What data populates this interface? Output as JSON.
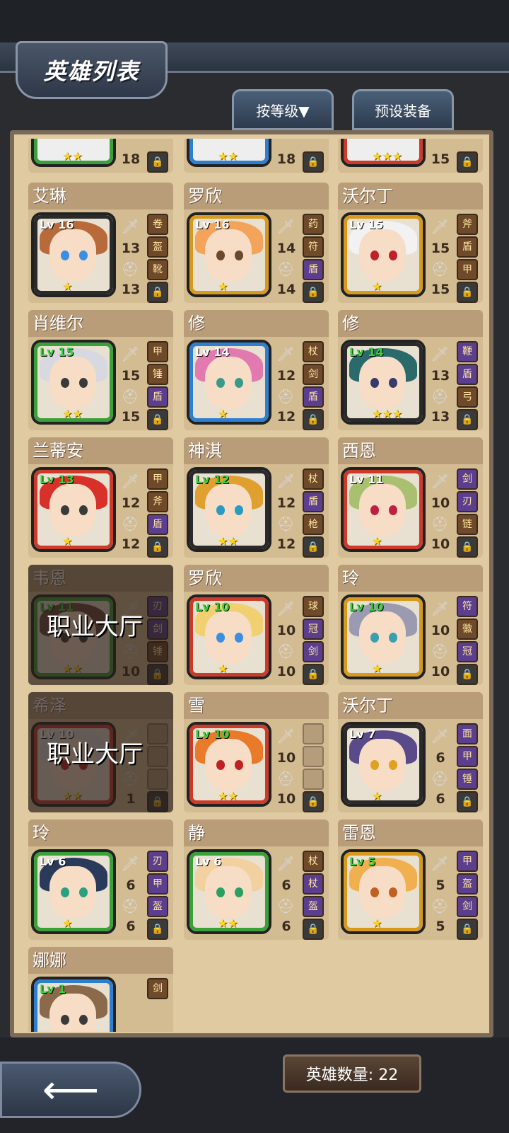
{
  "header": {
    "title": "英雄列表"
  },
  "toolbar": {
    "sort_label": "按等级▼",
    "preset_label": "预设装备"
  },
  "footer": {
    "hero_count": "英雄数量: 22"
  },
  "top_partial": [
    {
      "level_top": "18",
      "stars": "★★",
      "frame": "#3aa03a"
    },
    {
      "level_top": "18",
      "stars": "★★",
      "frame": "#2e7fd0"
    },
    {
      "level_top": "15",
      "stars": "★★★",
      "frame": "#cc3a2a"
    }
  ],
  "heroes": [
    {
      "name": "艾琳",
      "lv": "Lv 16",
      "lv_green": false,
      "frame": "#2a2a2a",
      "hair": "#b86a3a",
      "eye": "#3a8fe0",
      "stars": "★",
      "a": "13",
      "b": "13",
      "slots": [
        "卷",
        "盔",
        "靴",
        "锁"
      ],
      "slot_purple": [
        false,
        false,
        false
      ]
    },
    {
      "name": "罗欣",
      "lv": "Lv 16",
      "lv_green": false,
      "frame": "#d89a1e",
      "hair": "#f4a45a",
      "eye": "#6a4a2a",
      "stars": "★",
      "a": "14",
      "b": "14",
      "slots": [
        "药",
        "符",
        "盾",
        "锁"
      ],
      "slot_purple": [
        false,
        false,
        true
      ]
    },
    {
      "name": "沃尔丁",
      "lv": "Lv 15",
      "lv_green": false,
      "frame": "#d89a1e",
      "hair": "#f2f2f2",
      "eye": "#c0202a",
      "stars": "★",
      "a": "15",
      "b": "15",
      "slots": [
        "斧",
        "盾",
        "甲",
        "锁"
      ],
      "slot_purple": [
        false,
        false,
        false
      ]
    },
    {
      "name": "肖维尔",
      "lv": "Lv 15",
      "lv_green": true,
      "frame": "#3aa03a",
      "hair": "#d8d8e0",
      "eye": "#3a3a3a",
      "stars": "★★",
      "a": "15",
      "b": "15",
      "slots": [
        "甲",
        "锤",
        "盾",
        "锁"
      ],
      "slot_purple": [
        false,
        false,
        true
      ]
    },
    {
      "name": "修",
      "lv": "Lv 14",
      "lv_green": false,
      "frame": "#2e7fd0",
      "hair": "#e27ab0",
      "eye": "#3a9a8a",
      "stars": "★",
      "a": "12",
      "b": "12",
      "slots": [
        "杖",
        "剑",
        "盾",
        "锁"
      ],
      "slot_purple": [
        false,
        false,
        true
      ]
    },
    {
      "name": "修",
      "lv": "Lv 14",
      "lv_green": true,
      "frame": "#2a2a2a",
      "hair": "#2a6a6a",
      "eye": "#3a3a6a",
      "stars": "★★★",
      "a": "13",
      "b": "13",
      "slots": [
        "鞭",
        "盾",
        "弓",
        "锁"
      ],
      "slot_purple": [
        true,
        true,
        false
      ]
    },
    {
      "name": "兰蒂安",
      "lv": "Lv 13",
      "lv_green": true,
      "frame": "#cc3a2a",
      "hair": "#d8302a",
      "eye": "#3a3a3a",
      "stars": "★",
      "a": "12",
      "b": "12",
      "slots": [
        "甲",
        "斧",
        "盾",
        "锁"
      ],
      "slot_purple": [
        false,
        false,
        true
      ]
    },
    {
      "name": "神淇",
      "lv": "Lv 12",
      "lv_green": true,
      "frame": "#2a2a2a",
      "hair": "#e0a030",
      "eye": "#2a9ac0",
      "stars": "★★",
      "a": "12",
      "b": "12",
      "slots": [
        "杖",
        "盾",
        "枪",
        "锁"
      ],
      "slot_purple": [
        false,
        true,
        false
      ]
    },
    {
      "name": "西恩",
      "lv": "Lv 11",
      "lv_green": false,
      "frame": "#cc3a2a",
      "hair": "#a8c070",
      "eye": "#c02040",
      "stars": "★",
      "a": "10",
      "b": "10",
      "slots": [
        "剑",
        "刃",
        "链",
        "锁"
      ],
      "slot_purple": [
        true,
        true,
        false
      ]
    },
    {
      "name": "韦恩",
      "lv": "Lv 11",
      "lv_green": true,
      "frame": "#3aa03a",
      "hair": "#6a4a3a",
      "eye": "#3a3a3a",
      "stars": "★★",
      "a": "",
      "b": "10",
      "slots": [
        "刃",
        "剑",
        "锤",
        "锁"
      ],
      "slot_purple": [
        true,
        true,
        false
      ],
      "dimmed": true,
      "dim_label": "职业大厅"
    },
    {
      "name": "罗欣",
      "lv": "Lv 10",
      "lv_green": true,
      "frame": "#cc3a2a",
      "hair": "#f0d070",
      "eye": "#3a8fe0",
      "stars": "★",
      "a": "10",
      "b": "10",
      "slots": [
        "球",
        "冠",
        "剑",
        "锁"
      ],
      "slot_purple": [
        false,
        true,
        true
      ]
    },
    {
      "name": "玲",
      "lv": "Lv 10",
      "lv_green": true,
      "frame": "#d89a1e",
      "hair": "#9a9ab0",
      "eye": "#3aa0b0",
      "stars": "★",
      "a": "10",
      "b": "10",
      "slots": [
        "符",
        "徽",
        "冠",
        "锁"
      ],
      "slot_purple": [
        true,
        false,
        true
      ]
    },
    {
      "name": "希泽",
      "lv": "Lv 10",
      "lv_green": false,
      "frame": "#cc3a2a",
      "hair": "#d8d8d8",
      "eye": "#c02020",
      "stars": "★★",
      "a": "",
      "b": "1",
      "slots": [
        "",
        "",
        "",
        "锁"
      ],
      "slot_purple": [
        false,
        false,
        false
      ],
      "dimmed": true,
      "dim_label": "职业大厅",
      "empty": true
    },
    {
      "name": "雪",
      "lv": "Lv 10",
      "lv_green": true,
      "frame": "#cc3a2a",
      "hair": "#e87a2a",
      "eye": "#c02020",
      "stars": "★★",
      "a": "10",
      "b": "10",
      "slots": [
        "",
        "",
        "",
        "锁"
      ],
      "slot_purple": [
        false,
        false,
        false
      ],
      "empty": true
    },
    {
      "name": "沃尔丁",
      "lv": "Lv 7",
      "lv_green": false,
      "frame": "#2a2a2a",
      "hair": "#5a4a8a",
      "eye": "#e0a020",
      "stars": "★",
      "a": "6",
      "b": "6",
      "slots": [
        "面",
        "甲",
        "锤",
        "锁"
      ],
      "slot_purple": [
        true,
        true,
        true
      ]
    },
    {
      "name": "玲",
      "lv": "Lv 6",
      "lv_green": false,
      "frame": "#3aa03a",
      "hair": "#2a3a5a",
      "eye": "#2aa080",
      "stars": "★",
      "a": "6",
      "b": "6",
      "slots": [
        "刃",
        "甲",
        "盔",
        "锁"
      ],
      "slot_purple": [
        true,
        true,
        true
      ]
    },
    {
      "name": "静",
      "lv": "Lv 6",
      "lv_green": false,
      "frame": "#3aa03a",
      "hair": "#f2d0a0",
      "eye": "#2aa060",
      "stars": "★★",
      "a": "6",
      "b": "6",
      "slots": [
        "杖",
        "杖",
        "盔",
        "锁"
      ],
      "slot_purple": [
        false,
        true,
        true
      ]
    },
    {
      "name": "雷恩",
      "lv": "Lv 5",
      "lv_green": true,
      "frame": "#d89a1e",
      "hair": "#f0b050",
      "eye": "#c06020",
      "stars": "★",
      "a": "5",
      "b": "5",
      "slots": [
        "甲",
        "盔",
        "剑",
        "锁"
      ],
      "slot_purple": [
        true,
        true,
        true
      ]
    },
    {
      "name": "娜娜",
      "lv": "Lv 1",
      "lv_green": true,
      "frame": "#2e7fd0",
      "hair": "#8a6a4a",
      "eye": "#3a3a3a",
      "stars": "",
      "a": "",
      "b": "",
      "slots": [
        "剑",
        "",
        "",
        ""
      ],
      "slot_purple": [
        false,
        false,
        false
      ],
      "partial": true
    }
  ]
}
